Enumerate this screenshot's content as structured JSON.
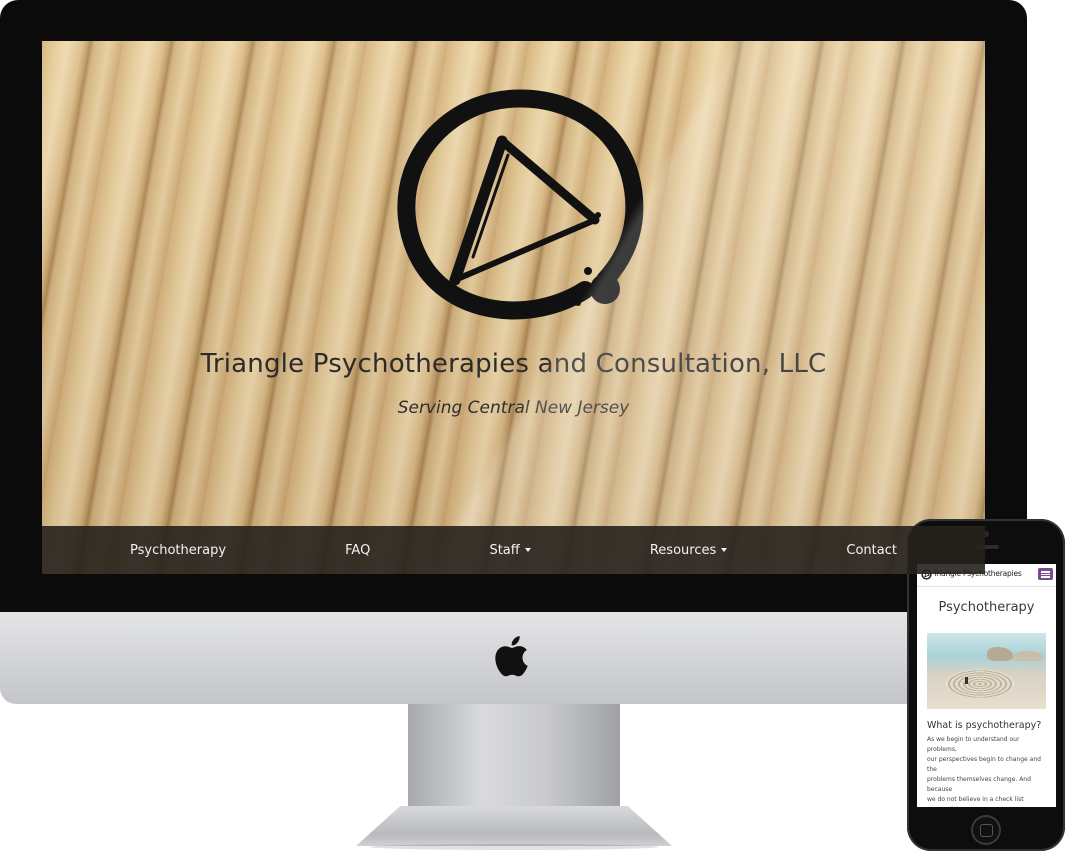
{
  "desktop": {
    "site_title": "Triangle Psychotherapies and Consultation, LLC",
    "tagline": "Serving Central New Jersey",
    "nav": [
      {
        "label": "Psychotherapy",
        "dropdown": false
      },
      {
        "label": "FAQ",
        "dropdown": false
      },
      {
        "label": "Staff",
        "dropdown": true
      },
      {
        "label": "Resources",
        "dropdown": true
      },
      {
        "label": "Contact",
        "dropdown": false
      }
    ],
    "nav_background": "#26211d",
    "hero_background": "bamboo"
  },
  "mobile": {
    "brand": "Triangle Psychotherapies",
    "menu_button_color": "#7a4a8c",
    "page_title": "Psychotherapy",
    "section_heading": "What is psychotherapy?",
    "body_text": "As we begin to understand our problems,\nour perspectives begin to change and the\nproblems themselves change. And because\nwe do not believe in a check list approach to\ndiagnosis at our practice, our approach to\ndiagnosis is guided by caution, deeper\nunderstanding, often over longer periods of"
  }
}
